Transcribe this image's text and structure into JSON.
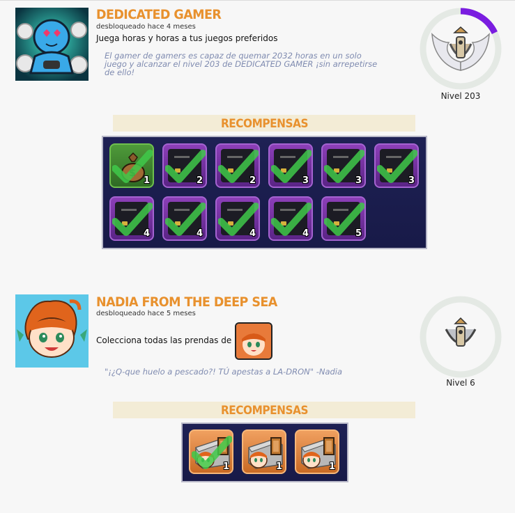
{
  "achievements": [
    {
      "title": "DEDICATED GAMER",
      "unlocked": "desbloqueado hace 4 meses",
      "description": "Juega horas y horas a tus juegos preferidos",
      "quote_line1": "El gamer de gamers es capaz de quemar 2032 horas en un solo",
      "quote_line2": "juego y alcanzar el nivel 203 de DEDICATED GAMER ¡sin arrepetirse",
      "quote_line3": "de ello!",
      "level_label": "Nivel 203",
      "level_progress": 0.18,
      "icon": "gamer-meditating-icon",
      "badge_icon": "winged-crest-badge-icon",
      "rewards_title": "RECOMPENSAS",
      "rewards": [
        {
          "type": "money-bag",
          "count": "1",
          "claimed": true
        },
        {
          "type": "card",
          "count": "2",
          "claimed": true
        },
        {
          "type": "card",
          "count": "2",
          "claimed": true
        },
        {
          "type": "card",
          "count": "3",
          "claimed": true
        },
        {
          "type": "card",
          "count": "3",
          "claimed": true
        },
        {
          "type": "card",
          "count": "3",
          "claimed": true
        },
        {
          "type": "card",
          "count": "4",
          "claimed": true
        },
        {
          "type": "card",
          "count": "4",
          "claimed": true
        },
        {
          "type": "card",
          "count": "4",
          "claimed": true
        },
        {
          "type": "card",
          "count": "4",
          "claimed": true
        },
        {
          "type": "card",
          "count": "5",
          "claimed": true
        }
      ]
    },
    {
      "title": "NADIA FROM THE DEEP SEA",
      "unlocked": "desbloqueado hace 5 meses",
      "description": "Colecciona todas las prendas de",
      "quote_line1": "\"¡¿Q-que huelo a pescado?! TÚ apestas a LA-DRON\" -Nadia",
      "level_label": "Nivel 6",
      "level_progress": 0,
      "icon": "nadia-portrait-icon",
      "badge_icon": "anchor-crest-badge-icon",
      "rewards_title": "RECOMPENSAS",
      "rewards": [
        {
          "type": "nadia-box",
          "count": "1",
          "claimed": true
        },
        {
          "type": "nadia-box",
          "count": "1",
          "claimed": false
        },
        {
          "type": "nadia-box",
          "count": "1",
          "claimed": false
        }
      ]
    }
  ],
  "colors": {
    "title_orange": "#e8912e",
    "ring_track": "#e4e9e4",
    "ring_progress": "#7a1de0",
    "quote_blue": "#7f8bb0",
    "panel_navy": "#1e2154"
  }
}
